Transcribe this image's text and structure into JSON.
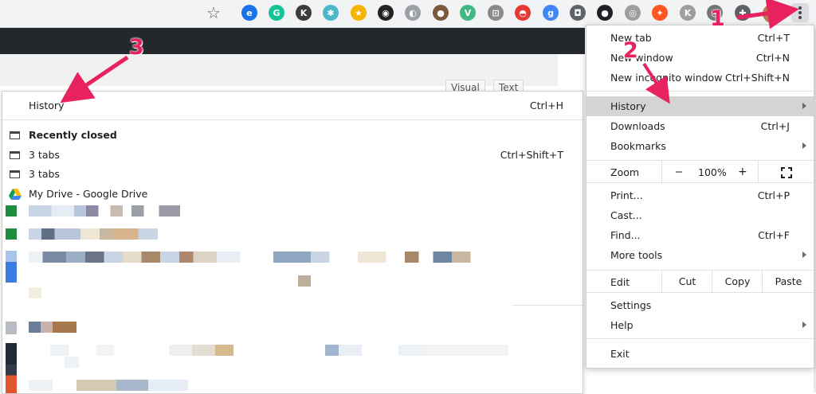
{
  "toolbar": {
    "star": "☆",
    "extensions": [
      {
        "name": "extension-blue-e-icon",
        "color": "#1a73e8",
        "glyph": "e"
      },
      {
        "name": "extension-grammarly-icon",
        "color": "#15c39a",
        "glyph": "G"
      },
      {
        "name": "extension-k-dark-icon",
        "color": "#3c3c3c",
        "glyph": "K"
      },
      {
        "name": "extension-network-icon",
        "color": "#4db6c9",
        "glyph": "✱"
      },
      {
        "name": "extension-star-icon",
        "color": "#f4b400",
        "glyph": "★"
      },
      {
        "name": "extension-yellow-ring-icon",
        "color": "#222222",
        "glyph": "◉"
      },
      {
        "name": "extension-grayscale-icon",
        "color": "#9aa0a6",
        "glyph": "◐"
      },
      {
        "name": "extension-cookie-icon",
        "color": "#7b5a3c",
        "glyph": "●"
      },
      {
        "name": "extension-vuejs-icon",
        "color": "#41b883",
        "glyph": "V"
      },
      {
        "name": "extension-gray-box-icon",
        "color": "#8a8a8a",
        "glyph": "⊡"
      },
      {
        "name": "extension-pokeball-icon",
        "color": "#e53935",
        "glyph": "◓"
      },
      {
        "name": "extension-g-blue-icon",
        "color": "#4285f4",
        "glyph": "g"
      },
      {
        "name": "extension-camera-icon",
        "color": "#5f6368",
        "glyph": "◘"
      },
      {
        "name": "extension-chat-icon",
        "color": "#202124",
        "glyph": "●"
      },
      {
        "name": "extension-compass-icon",
        "color": "#9e9e9e",
        "glyph": "◎"
      },
      {
        "name": "extension-orange-icon",
        "color": "#ff5722",
        "glyph": "✦"
      },
      {
        "name": "extension-k-gray-icon",
        "color": "#9e9e9e",
        "glyph": "K"
      },
      {
        "name": "extension-clock-icon",
        "color": "#757575",
        "glyph": "◔"
      },
      {
        "name": "extensions-puzzle-icon",
        "color": "#5f6368",
        "glyph": "✚"
      }
    ]
  },
  "editor_tabs": {
    "visual": "Visual",
    "text": "Text"
  },
  "history_menu": {
    "history": {
      "label": "History",
      "shortcut": "Ctrl+H"
    },
    "recently_closed": "Recently closed",
    "items": [
      {
        "label": "3 tabs",
        "shortcut": "Ctrl+Shift+T"
      },
      {
        "label": "3 tabs",
        "shortcut": ""
      },
      {
        "label": "My Drive - Google Drive",
        "shortcut": ""
      }
    ]
  },
  "main_menu": {
    "new_tab": {
      "label": "New tab",
      "shortcut": "Ctrl+T"
    },
    "new_window": {
      "label": "New window",
      "shortcut": "Ctrl+N"
    },
    "new_incognito": {
      "label": "New incognito window",
      "shortcut": "Ctrl+Shift+N"
    },
    "history": "History",
    "downloads": {
      "label": "Downloads",
      "shortcut": "Ctrl+J"
    },
    "bookmarks": "Bookmarks",
    "zoom": {
      "label": "Zoom",
      "minus": "−",
      "level": "100%",
      "plus": "+"
    },
    "print": {
      "label": "Print...",
      "shortcut": "Ctrl+P"
    },
    "cast": "Cast...",
    "find": {
      "label": "Find...",
      "shortcut": "Ctrl+F"
    },
    "more_tools": "More tools",
    "edit": {
      "label": "Edit",
      "cut": "Cut",
      "copy": "Copy",
      "paste": "Paste"
    },
    "settings": "Settings",
    "help": "Help",
    "exit": "Exit"
  },
  "annotations": {
    "one": "1",
    "two": "2",
    "three": "3"
  },
  "colors": {
    "accent_pink": "#e8225f",
    "highlight": "#d4d4d4"
  }
}
